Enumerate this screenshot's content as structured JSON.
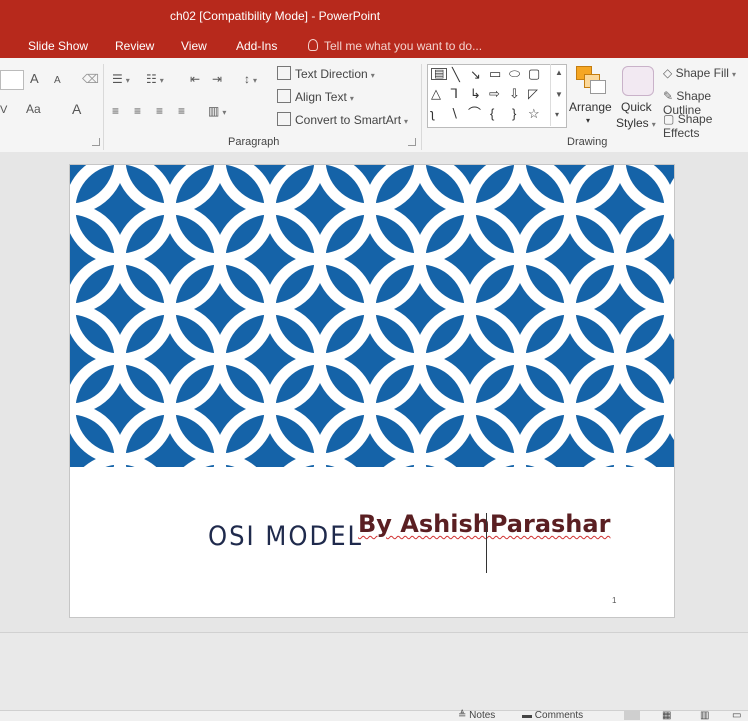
{
  "window": {
    "title": "ch02 [Compatibility Mode] - PowerPoint"
  },
  "tabs": [
    "Slide Show",
    "Review",
    "View",
    "Add-Ins"
  ],
  "tell_me": "Tell me what you want to do...",
  "ribbon": {
    "font_group": {
      "grow": "A",
      "shrink": "A",
      "aa": "Aa",
      "font_color": "A",
      "v": "V"
    },
    "paragraph": {
      "label": "Paragraph",
      "text_direction": "Text Direction",
      "align_text": "Align Text",
      "convert_smartart": "Convert to SmartArt"
    },
    "drawing": {
      "label": "Drawing",
      "arrange": "Arrange",
      "quick_styles_1": "Quick",
      "quick_styles_2": "Styles",
      "shape_fill": "Shape Fill",
      "shape_outline": "Shape Outline",
      "shape_effects": "Shape Effects"
    }
  },
  "slide": {
    "title": "OSI MODEL",
    "subtitle": "By AshishParashar",
    "number": "1",
    "colors": {
      "pattern_blue": "#1563a8",
      "title": "#1f2a4c",
      "subtitle": "#5a1f22"
    }
  },
  "status": {
    "notes": "Notes",
    "comments": "Comments"
  }
}
